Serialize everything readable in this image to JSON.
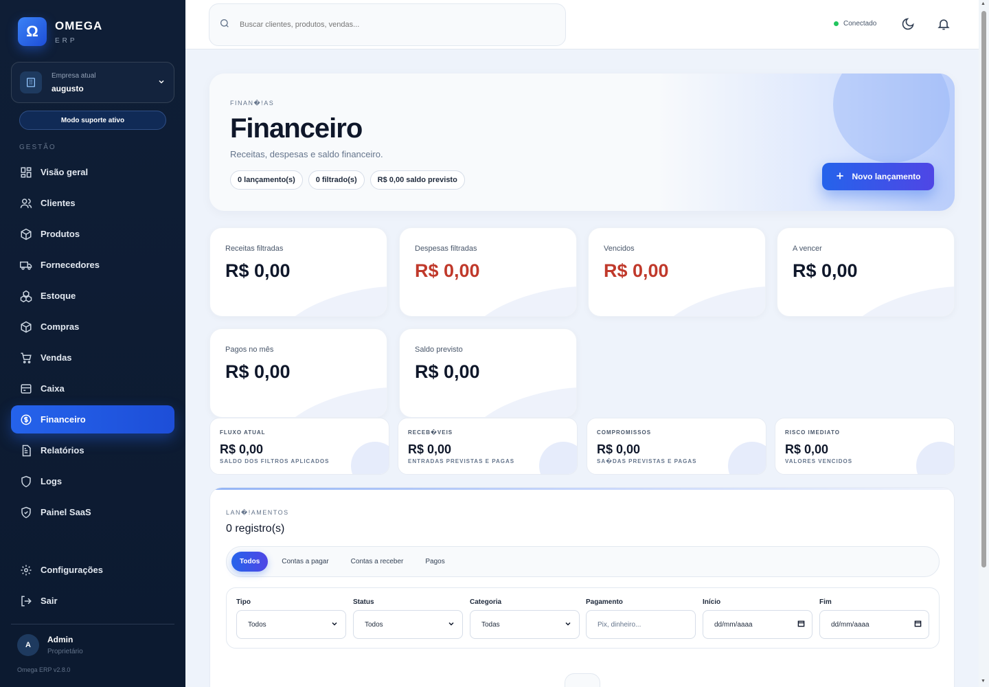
{
  "brand": {
    "logo_glyph": "Ω",
    "name": "OMEGA",
    "sub": "ERP"
  },
  "company": {
    "label": "Empresa atual",
    "value": "augusto"
  },
  "support_mode": "Modo suporte ativo",
  "sidebar": {
    "section_label": "GESTÃO",
    "items": [
      {
        "label": "Visão geral",
        "icon": "grid-icon"
      },
      {
        "label": "Clientes",
        "icon": "users-icon"
      },
      {
        "label": "Produtos",
        "icon": "package-icon"
      },
      {
        "label": "Fornecedores",
        "icon": "truck-icon"
      },
      {
        "label": "Estoque",
        "icon": "boxes-icon"
      },
      {
        "label": "Compras",
        "icon": "package-icon"
      },
      {
        "label": "Vendas",
        "icon": "cart-icon"
      },
      {
        "label": "Caixa",
        "icon": "cash-register-icon"
      },
      {
        "label": "Financeiro",
        "icon": "dollar-circle-icon",
        "active": true
      },
      {
        "label": "Relatórios",
        "icon": "report-icon"
      },
      {
        "label": "Logs",
        "icon": "shield-icon"
      },
      {
        "label": "Painel SaaS",
        "icon": "shield-check-icon"
      }
    ],
    "bottom": [
      {
        "label": "Configurações",
        "icon": "gear-icon"
      },
      {
        "label": "Sair",
        "icon": "logout-icon"
      }
    ]
  },
  "user": {
    "initial": "A",
    "name": "Admin",
    "role": "Proprietário"
  },
  "version": "Omega ERP v2.8.0",
  "topbar": {
    "search_placeholder": "Buscar clientes, produtos, vendas...",
    "status": "Conectado"
  },
  "hero": {
    "eyebrow": "FINAN�!AS",
    "title": "Financeiro",
    "subtitle": "Receitas, despesas e saldo financeiro.",
    "chips": [
      "0 lançamento(s)",
      "0 filtrado(s)",
      "R$ 0,00 saldo previsto"
    ],
    "new_button": "Novo lançamento"
  },
  "stats": [
    {
      "label": "Receitas filtradas",
      "value": "R$ 0,00",
      "color": "#0f172a"
    },
    {
      "label": "Despesas filtradas",
      "value": "R$ 0,00",
      "color": "#c0392b"
    },
    {
      "label": "Vencidos",
      "value": "R$ 0,00",
      "color": "#c0392b"
    },
    {
      "label": "A vencer",
      "value": "R$ 0,00",
      "color": "#0f172a"
    },
    {
      "label": "Pagos no mês",
      "value": "R$ 0,00",
      "color": "#0f172a"
    },
    {
      "label": "Saldo previsto",
      "value": "R$ 0,00",
      "color": "#0f172a"
    }
  ],
  "mini": [
    {
      "label": "FLUXO ATUAL",
      "value": "R$ 0,00",
      "desc": "SALDO DOS FILTROS APLICADOS"
    },
    {
      "label": "RECEB�VEIS",
      "value": "R$ 0,00",
      "desc": "ENTRADAS PREVISTAS E PAGAS"
    },
    {
      "label": "COMPROMISSOS",
      "value": "R$ 0,00",
      "desc": "SA�DAS PREVISTAS E PAGAS"
    },
    {
      "label": "RISCO IMEDIATO",
      "value": "R$ 0,00",
      "desc": "VALORES VENCIDOS"
    }
  ],
  "lancamentos": {
    "eyebrow": "LAN�!AMENTOS",
    "title": "0 registro(s)",
    "tabs": [
      "Todos",
      "Contas a pagar",
      "Contas a receber",
      "Pagos"
    ],
    "filters": [
      {
        "label": "Tipo",
        "value": "Todos",
        "kind": "select"
      },
      {
        "label": "Status",
        "value": "Todos",
        "kind": "select"
      },
      {
        "label": "Categoria",
        "value": "Todas",
        "kind": "select"
      },
      {
        "label": "Pagamento",
        "placeholder": "Pix, dinheiro...",
        "kind": "text"
      },
      {
        "label": "Início",
        "value": "dd/mm/aaaa",
        "kind": "date"
      },
      {
        "label": "Fim",
        "value": "dd/mm/aaaa",
        "kind": "date"
      }
    ]
  }
}
